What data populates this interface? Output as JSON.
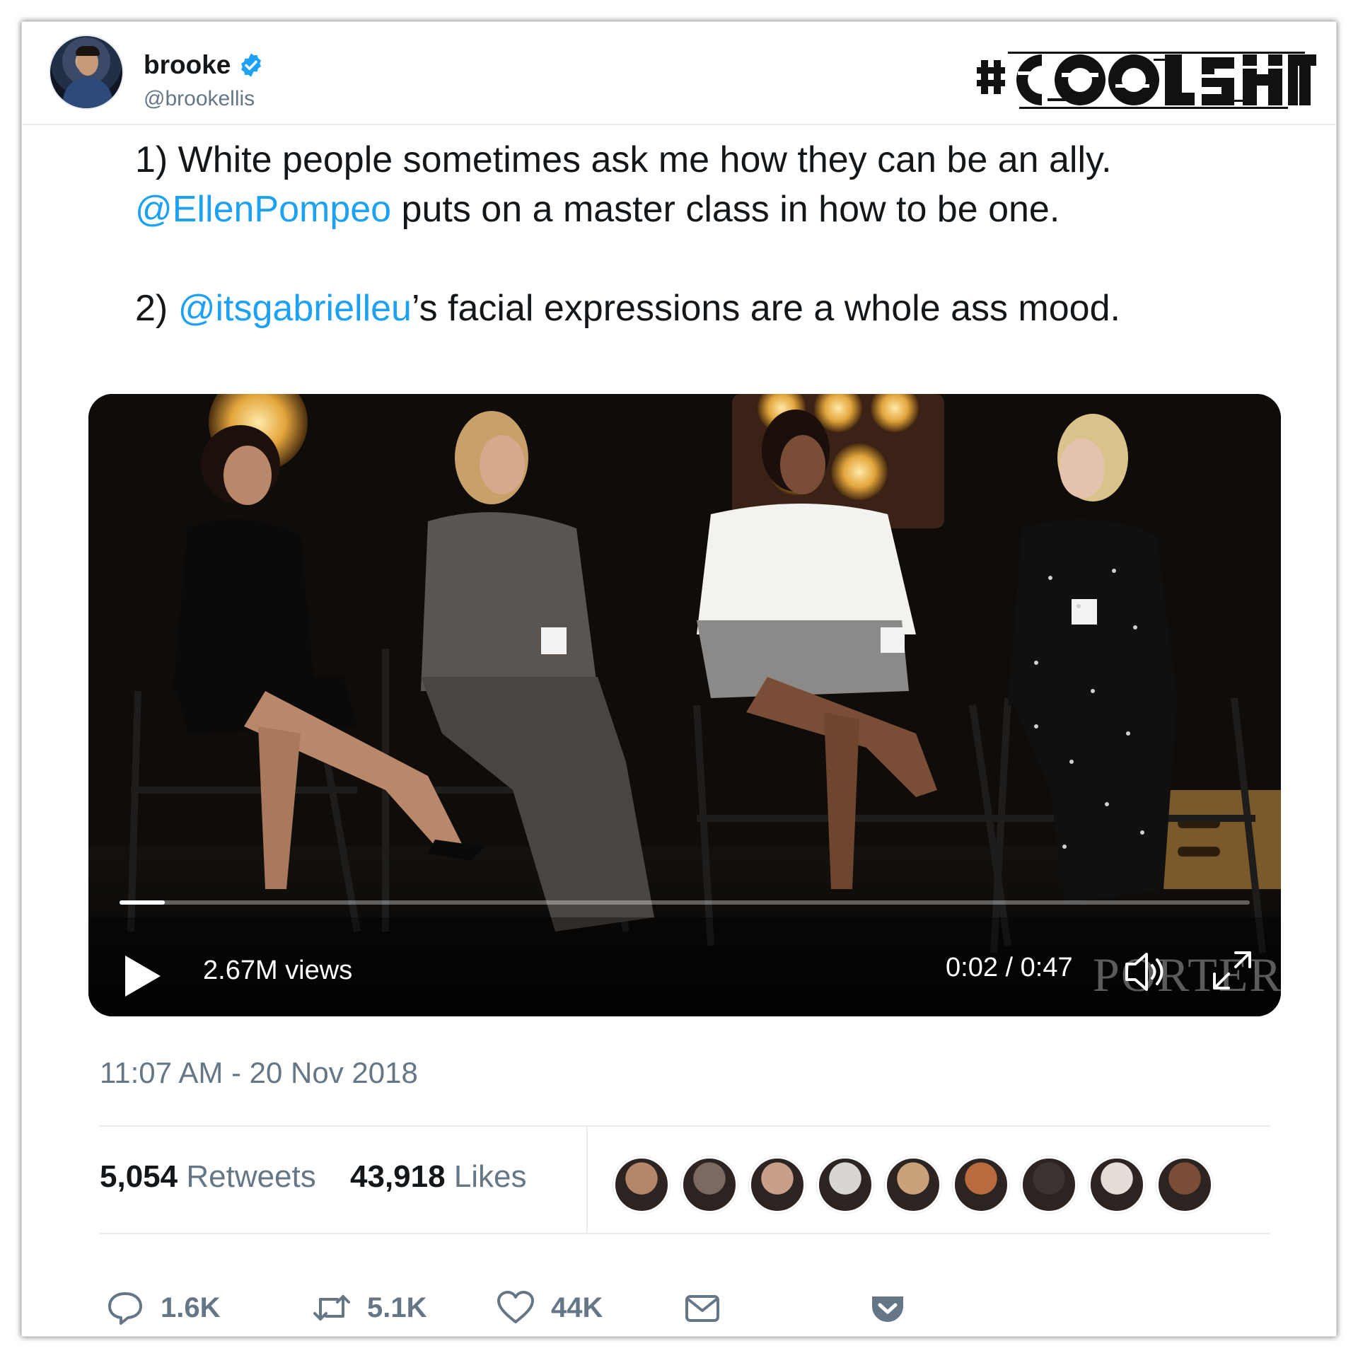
{
  "author": {
    "display_name": "brooke",
    "handle": "@brookellis",
    "verified": true,
    "avatar_icon": "profile-photo"
  },
  "brand": {
    "logo_text": "#COOLSHIT",
    "logo_style": "distorted-glitch"
  },
  "tweet": {
    "line1": "1) White people sometimes ask me how they can be an ally.",
    "line2_mention": "@EllenPompeo",
    "line2_rest": " puts on a master class in how to be one.",
    "line3_prefix": "2) ",
    "line3_mention": "@itsgabrielleu",
    "line3_rest": "’s facial expressions are a whole ass mood."
  },
  "video": {
    "views": "2.67M views",
    "time": "0:02 / 0:47",
    "progress": 0.04,
    "watermark": "PORTER",
    "play_icon": "play-icon",
    "volume_icon": "volume-icon",
    "fullscreen_icon": "fullscreen-icon"
  },
  "meta": {
    "timestamp": "11:07 AM - 20 Nov 2018",
    "retweets_count": "5,054",
    "retweets_label": "Retweets",
    "likes_count": "43,918",
    "likes_label": "Likes"
  },
  "likers": [
    {
      "color": "#b5876a"
    },
    {
      "color": "#7a6a62"
    },
    {
      "color": "#c79f8a"
    },
    {
      "color": "#d9d6d2"
    },
    {
      "color": "#c9a27a"
    },
    {
      "color": "#b86b3e"
    },
    {
      "color": "#3a3330"
    },
    {
      "color": "#e4dcd6"
    },
    {
      "color": "#7a4e36"
    }
  ],
  "actions": {
    "reply_count": "1.6K",
    "retweet_count": "5.1K",
    "like_count": "44K"
  },
  "colors": {
    "link": "#1da1f2",
    "muted": "#657786",
    "text": "#14171a",
    "verified": "#1da1f2"
  }
}
